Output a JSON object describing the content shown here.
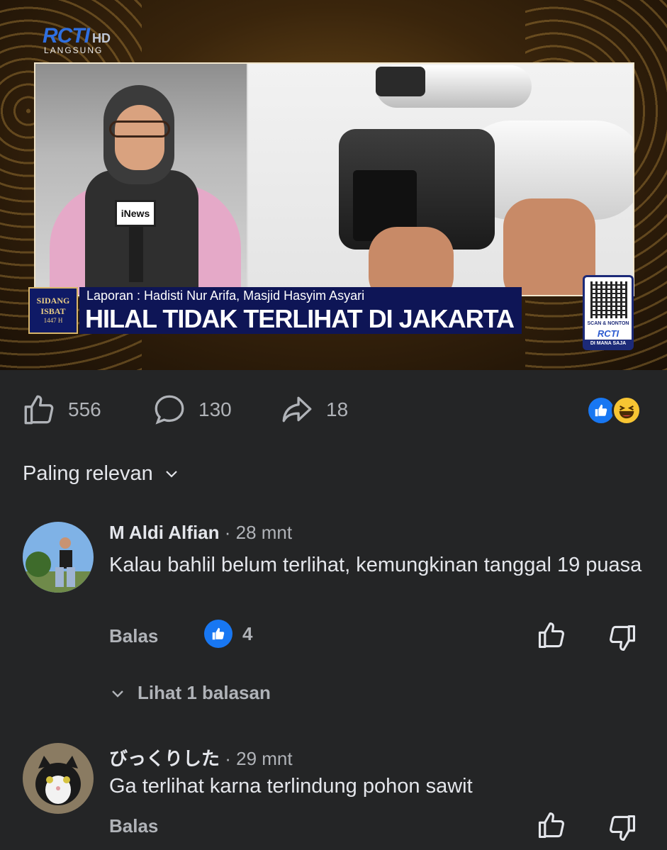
{
  "video": {
    "channel_logo": "RCTI",
    "channel_hd": "HD",
    "channel_live": "LANGSUNG",
    "mic_label": "iNews",
    "badge": {
      "line1": "SIDANG",
      "line2": "ISBAT",
      "line3": "1447 H"
    },
    "reporter_line": "Laporan : Hadisti Nur Arifa, Masjid Hasyim Asyari",
    "headline": "HILAL TIDAK TERLIHAT DI JAKARTA",
    "qr": {
      "scan": "SCAN & NONTON",
      "logo": "RCTI",
      "where": "DI MANA SAJA"
    }
  },
  "actions": {
    "likes": "556",
    "comments": "130",
    "shares": "18",
    "reactions": [
      "like-icon",
      "haha-icon"
    ]
  },
  "sort": {
    "label": "Paling relevan"
  },
  "comments": [
    {
      "name": "M Aldi Alfian",
      "time": "· 28 mnt",
      "text": "Kalau bahlil belum terlihat, kemungkinan tanggal 19 puasa",
      "reply_label": "Balas",
      "like_count": "4",
      "replies_label": "Lihat 1 balasan"
    },
    {
      "name": "びっくりした",
      "time": "· 29 mnt",
      "text": "Ga terlihat karna terlindung pohon sawit",
      "reply_label": "Balas"
    }
  ],
  "colors": {
    "background": "#242526",
    "text": "#e4e6eb",
    "muted": "#b0b3b8",
    "accent": "#1877f2",
    "headline_bg": "#0e1556"
  }
}
